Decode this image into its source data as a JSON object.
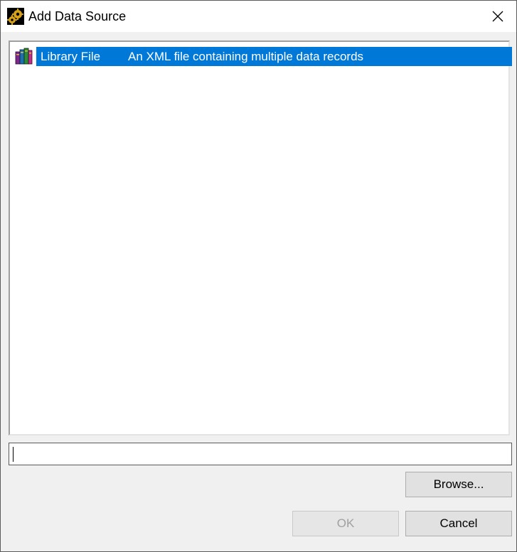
{
  "window": {
    "title": "Add Data Source",
    "icon": "gears-icon",
    "close_icon": "close-icon"
  },
  "list": {
    "items": [
      {
        "name": "Library File",
        "description": "An XML file containing multiple data records",
        "icon": "books-icon",
        "selected": true
      }
    ]
  },
  "path_input": {
    "value": ""
  },
  "buttons": {
    "browse_label": "Browse...",
    "ok_label": "OK",
    "cancel_label": "Cancel",
    "ok_enabled": false
  },
  "colors": {
    "selection": "#0078d7",
    "gear_gold": "#d4a017"
  }
}
